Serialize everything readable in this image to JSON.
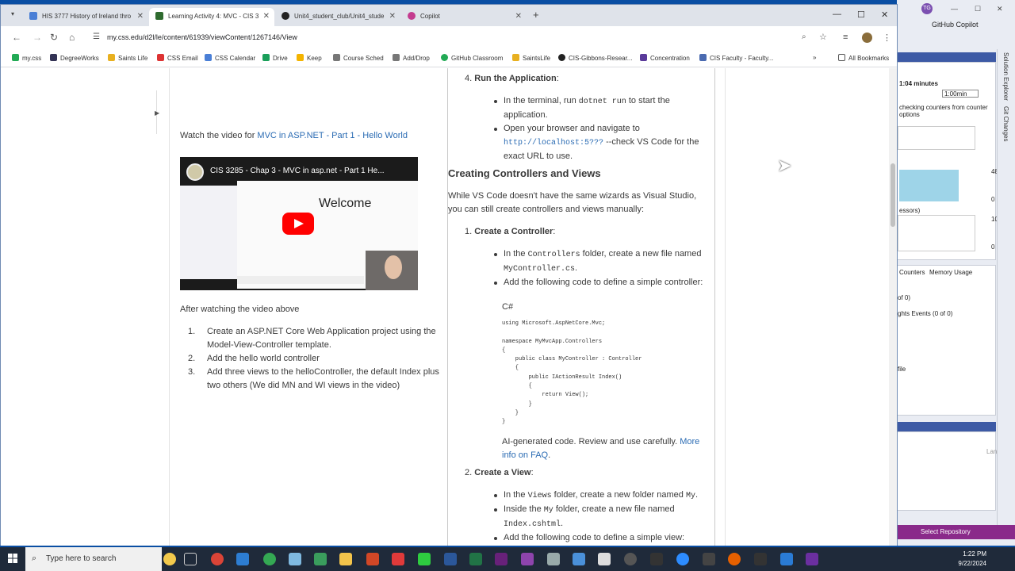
{
  "browser": {
    "tabs": [
      {
        "label": "HIS 3777 History of Ireland thro",
        "color": "#4a7fd6"
      },
      {
        "label": "Learning Activity 4: MVC - CIS 3",
        "color": "#2f6b2f"
      },
      {
        "label": "Unit4_student_club/Unit4_stude",
        "color": "#222222"
      },
      {
        "label": "Copilot",
        "color": "#c43b8f"
      }
    ],
    "url": "my.css.edu/d2l/le/content/61939/viewContent/1267146/View",
    "bookmarks": [
      "my.css",
      "DegreeWorks",
      "Saints Life",
      "CSS Email",
      "CSS Calendar",
      "Drive",
      "Keep",
      "Course Sched",
      "Add/Drop",
      "GitHub Classroom",
      "SaintsLife",
      "CIS-Gibbons-Resear...",
      "Concentration",
      "CIS Faculty - Faculty..."
    ],
    "all_bookmarks": "All Bookmarks"
  },
  "left": {
    "watch_prefix": "Watch the video for ",
    "watch_link": "MVC in ASP.NET - Part 1 - Hello World",
    "video_title": "CIS 3285 - Chap 3 - MVC in asp.net - Part 1 He...",
    "video_welcome": "Welcome",
    "after": "After watching the video above",
    "steps": [
      {
        "n": "1.",
        "text": "Create an ASP.NET Core Web Application project using the  Model-View-Controller template."
      },
      {
        "n": "2.",
        "text": "Add the hello world controller"
      },
      {
        "n": "3.",
        "text": "Add three views to the helloController, the default Index plus two others (We did MN and WI views in the video)"
      }
    ]
  },
  "right": {
    "run_n": "4.",
    "run_title": "Run the Application",
    "run_b1_a": "In the terminal, run ",
    "run_b1_code": "dotnet run",
    "run_b1_b": " to start the application.",
    "run_b2_a": "Open your browser and navigate to ",
    "run_b2_code": "http://localhost:5???",
    "run_b2_b": " --check VS Code for the exact URL to use.",
    "h_controllers": "Creating Controllers and Views",
    "intro": "While VS Code doesn't have the same wizards as Visual Studio, you can still create controllers and views manually:",
    "c_n": "1.",
    "c_title": "Create a Controller",
    "c_b1_a": "In the ",
    "c_b1_code": "Controllers",
    "c_b1_b": " folder, create a new file named ",
    "c_b1_code2": "MyController.cs",
    "c_b1_c": ".",
    "c_b2": "Add the following code to define a simple controller:",
    "c_lang": "C#",
    "code": "using Microsoft.AspNetCore.Mvc;\n\nnamespace MyMvcApp.Controllers\n{\n    public class MyController : Controller\n    {\n        public IActionResult Index()\n        {\n            return View();\n        }\n    }\n}",
    "ai_note": "AI-generated code. Review and use carefully. ",
    "ai_link": "More info on FAQ",
    "v_n": "2.",
    "v_title": "Create a View",
    "v_b1_a": "In the ",
    "v_b1_code": "Views",
    "v_b1_b": " folder, create a new folder named ",
    "v_b1_code2": "My",
    "v_b2_a": "Inside the ",
    "v_b2_code": "My",
    "v_b2_b": " folder, create a new file named ",
    "v_b2_code2": "Index.cshtml",
    "v_b3": "Add the following code to define a simple view:"
  },
  "vs": {
    "avatar": "TG",
    "copilot": "GitHub Copilot",
    "minutes": "1:04 minutes",
    "min_label": "1:00min",
    "counters_note": "checking counters from counter options",
    "v48": "48",
    "v0a": "0",
    "v100": "100",
    "v0b": "0",
    "processors": "essors)",
    "tab_counters": "Counters",
    "tab_memory": "Memory Usage",
    "of0": "of 0)",
    "events": "ghts Events (0 of 0)",
    "file": "file",
    "lang": "Lang",
    "side1": "Solution Explorer",
    "side2": "Git Changes",
    "status": "Select Repository"
  },
  "taskbar": {
    "search": "Type here to search",
    "time": "1:22 PM",
    "date": "9/22/2024"
  }
}
